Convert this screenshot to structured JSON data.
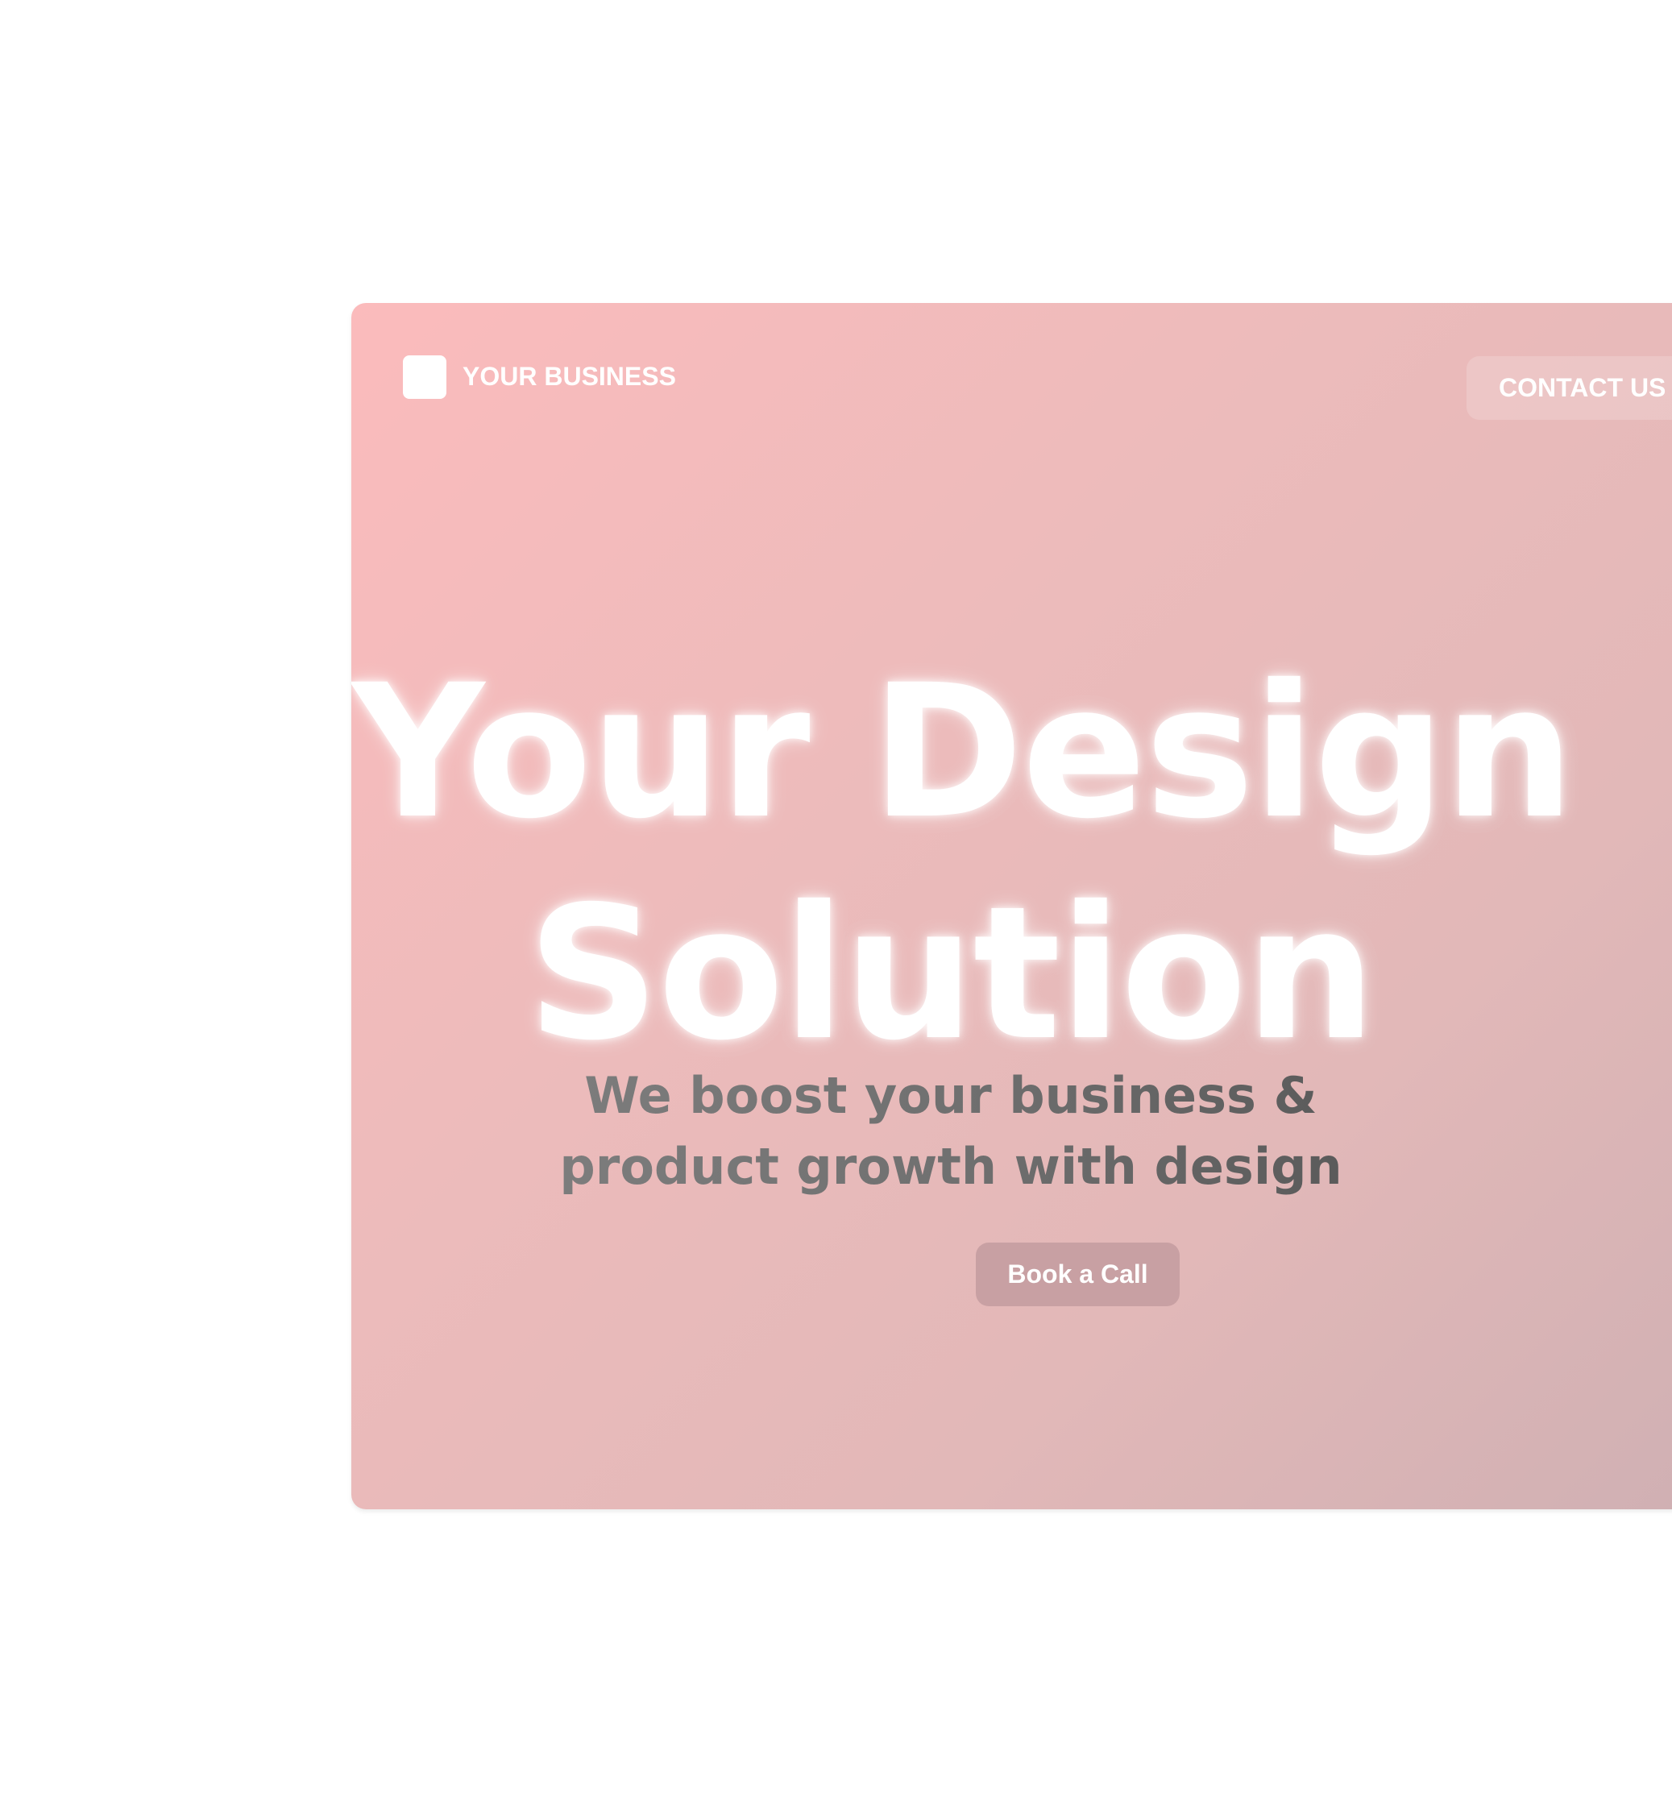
{
  "header": {
    "brand_name": "YOUR BUSINESS",
    "contact_label": "CONTACT US"
  },
  "hero": {
    "headline_line1": "Your Design",
    "headline_line2": "Solution",
    "subheading_line1": "We boost your business &",
    "subheading_line2": "product growth with design",
    "cta_label": "Book a Call"
  },
  "colors": {
    "gradient_start": "#fbbbbc",
    "gradient_end": "#d0b0b3",
    "cta_background": "#c8a0a3",
    "headline": "#ffffff",
    "subheading": "#6e6e6e"
  }
}
